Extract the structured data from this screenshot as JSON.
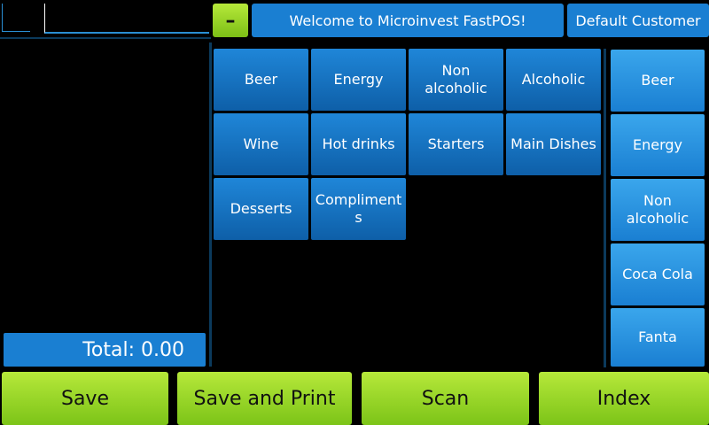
{
  "header": {
    "minus_label": "–",
    "welcome_text": "Welcome to Microinvest FastPOS!",
    "customer_label": "Default Customer"
  },
  "receipt": {
    "total_text": "Total: 0.00"
  },
  "categories": [
    "Beer",
    "Energy",
    "Non alcoholic",
    "Alcoholic",
    "Wine",
    "Hot drinks",
    "Starters",
    "Main Dishes",
    "Desserts",
    "Compliments"
  ],
  "products": [
    "Beer",
    "Energy",
    "Non alcoholic",
    "Coca Cola",
    "Fanta"
  ],
  "footer": {
    "save_label": "Save",
    "save_print_label": "Save and Print",
    "scan_label": "Scan",
    "index_label": "Index"
  },
  "colors": {
    "accent_blue": "#1a7fd2",
    "accent_green": "#9ad428"
  }
}
